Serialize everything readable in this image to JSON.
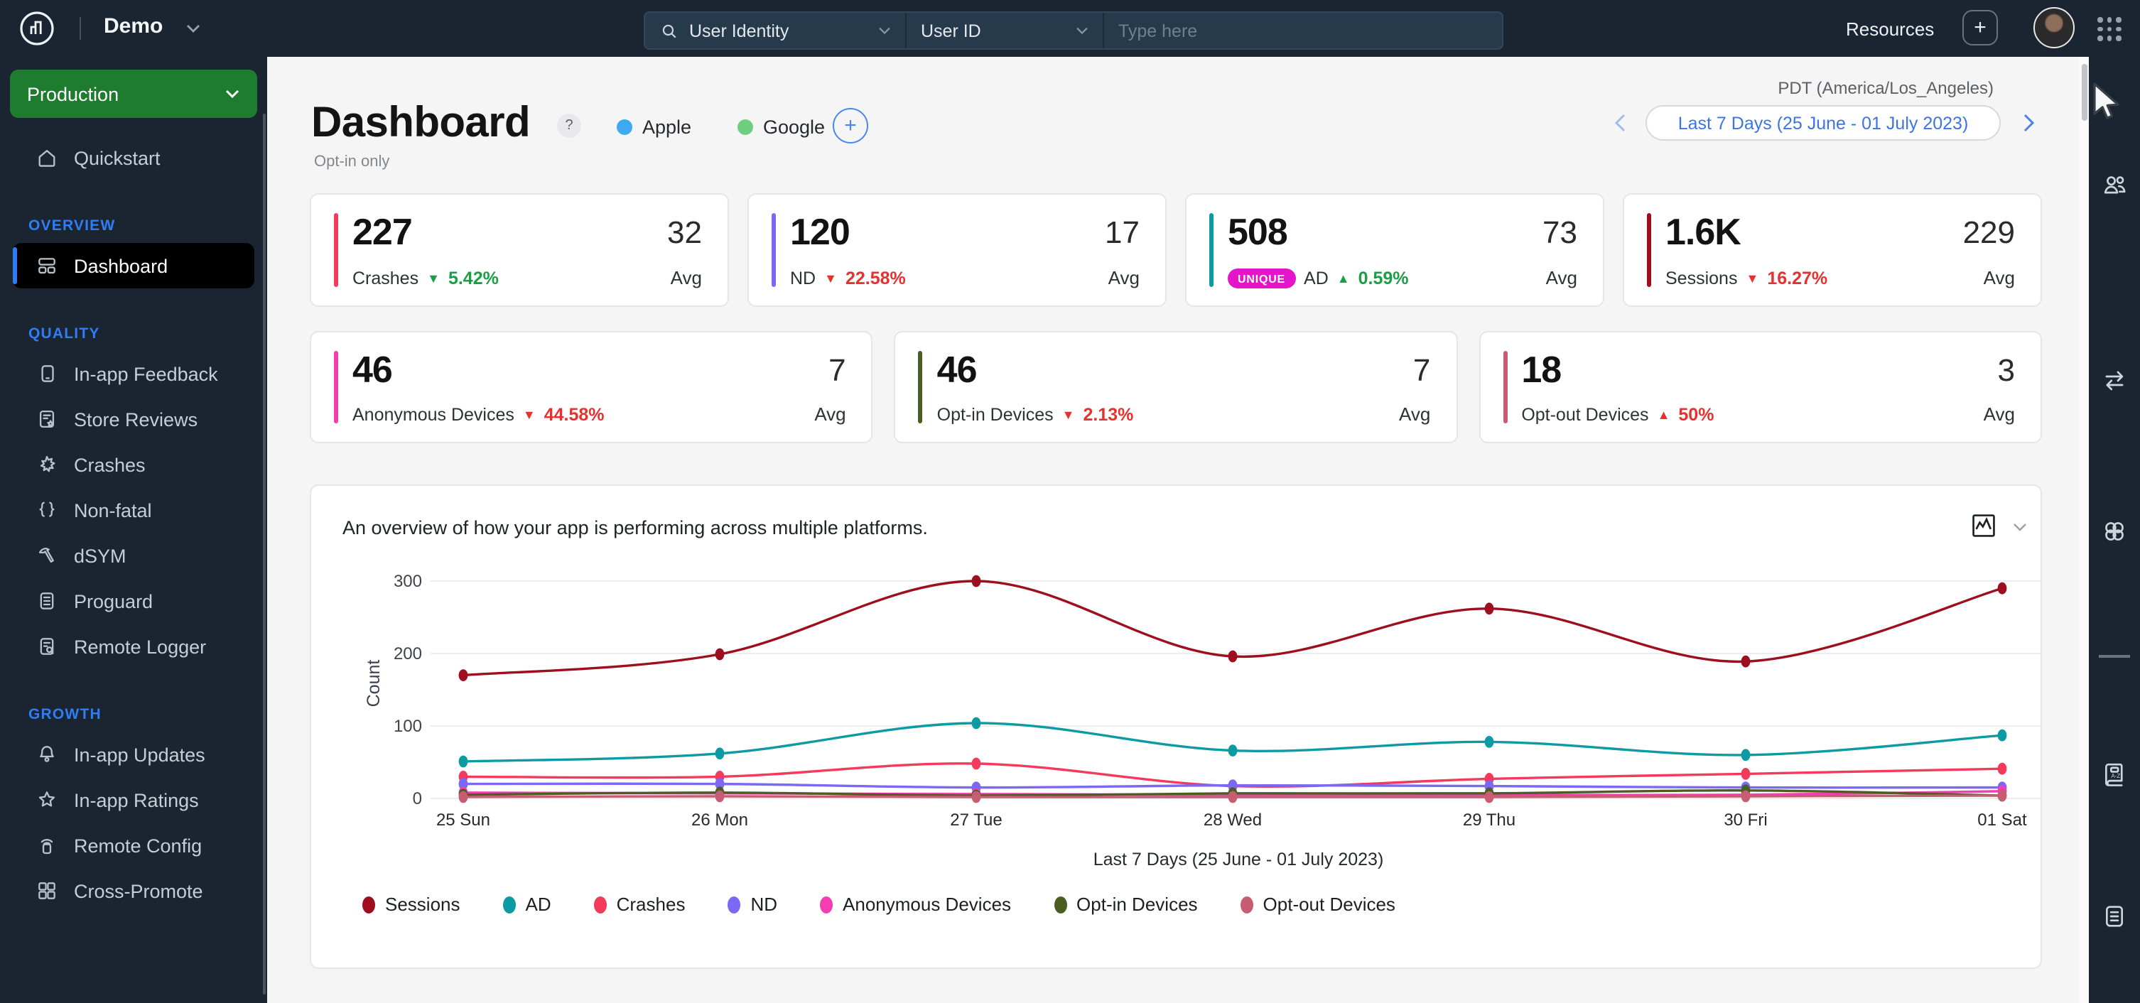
{
  "topbar": {
    "product_name": "Demo",
    "search": {
      "scope": "User Identity",
      "field": "User ID",
      "placeholder": "Type here"
    },
    "resources_label": "Resources",
    "colors": {
      "bar_bg": "#1b2531",
      "panel_bg": "#273a4c"
    }
  },
  "sidebar": {
    "environment": {
      "label": "Production",
      "color": "#1e7c2e"
    },
    "section_label_color": "#2e7df6",
    "groups": [
      {
        "label": "",
        "items": [
          {
            "label": "Quickstart",
            "icon": "home",
            "selected": false
          }
        ]
      },
      {
        "label": "OVERVIEW",
        "items": [
          {
            "label": "Dashboard",
            "icon": "dashboard",
            "selected": true
          }
        ]
      },
      {
        "label": "QUALITY",
        "items": [
          {
            "label": "In-app Feedback",
            "icon": "feedback",
            "selected": false
          },
          {
            "label": "Store Reviews",
            "icon": "store-reviews",
            "selected": false
          },
          {
            "label": "Crashes",
            "icon": "crashes",
            "selected": false
          },
          {
            "label": "Non-fatal",
            "icon": "non-fatal",
            "selected": false
          },
          {
            "label": "dSYM",
            "icon": "dsym",
            "selected": false
          },
          {
            "label": "Proguard",
            "icon": "proguard",
            "selected": false
          },
          {
            "label": "Remote Logger",
            "icon": "remote-logger",
            "selected": false
          }
        ]
      },
      {
        "label": "GROWTH",
        "items": [
          {
            "label": "In-app Updates",
            "icon": "bell",
            "selected": false
          },
          {
            "label": "In-app Ratings",
            "icon": "star",
            "selected": false
          },
          {
            "label": "Remote Config",
            "icon": "remote-config",
            "selected": false
          },
          {
            "label": "Cross-Promote",
            "icon": "cross-promote",
            "selected": false
          }
        ]
      }
    ]
  },
  "header": {
    "title": "Dashboard",
    "help_glyph": "?",
    "subtitle": "Opt-in only",
    "platforms": [
      {
        "label": "Apple",
        "color": "#3daaf0"
      },
      {
        "label": "Google",
        "color": "#6fcf7f"
      }
    ],
    "timezone": "PDT (America/Los_Angeles)",
    "date_range": "Last 7 Days (25 June - 01 July 2023)"
  },
  "stat_cards": [
    {
      "row": 1,
      "value": "227",
      "label": "Crashes",
      "badge": "",
      "delta": "5.42%",
      "delta_dir": "down",
      "delta_color": "#1d9e45",
      "avg_value": "32",
      "avg_label": "Avg",
      "accent": "#f43a5c"
    },
    {
      "row": 1,
      "value": "120",
      "label": "ND",
      "badge": "",
      "delta": "22.58%",
      "delta_dir": "down",
      "delta_color": "#e8312f",
      "avg_value": "17",
      "avg_label": "Avg",
      "accent": "#7b68f5"
    },
    {
      "row": 1,
      "value": "508",
      "label": "AD",
      "badge": "UNIQUE",
      "badge_color": "#e414ca",
      "delta": "0.59%",
      "delta_dir": "up",
      "delta_color": "#1d9e45",
      "avg_value": "73",
      "avg_label": "Avg",
      "accent": "#0d9ba3"
    },
    {
      "row": 1,
      "value": "1.6K",
      "label": "Sessions",
      "badge": "",
      "delta": "16.27%",
      "delta_dir": "down",
      "delta_color": "#e8312f",
      "avg_value": "229",
      "avg_label": "Avg",
      "accent": "#9e0e1e"
    },
    {
      "row": 2,
      "value": "46",
      "label": "Anonymous Devices",
      "badge": "",
      "delta": "44.58%",
      "delta_dir": "down",
      "delta_color": "#e8312f",
      "avg_value": "7",
      "avg_label": "Avg",
      "accent": "#f43eb0"
    },
    {
      "row": 2,
      "value": "46",
      "label": "Opt-in Devices",
      "badge": "",
      "delta": "2.13%",
      "delta_dir": "down",
      "delta_color": "#e8312f",
      "avg_value": "7",
      "avg_label": "Avg",
      "accent": "#4c5d24"
    },
    {
      "row": 2,
      "value": "18",
      "label": "Opt-out Devices",
      "badge": "",
      "delta": "50%",
      "delta_dir": "up",
      "delta_color": "#e8312f",
      "avg_value": "3",
      "avg_label": "Avg",
      "accent": "#c75d73"
    }
  ],
  "chart_data": {
    "type": "line",
    "title": "An overview of how your app is performing across multiple platforms.",
    "ylabel": "Count",
    "xlabel_caption": "Last 7 Days (25 June - 01 July 2023)",
    "ylim": [
      0,
      300
    ],
    "yticks": [
      0,
      100,
      200,
      300
    ],
    "grid": true,
    "legend_position": "bottom",
    "categories": [
      "25 Sun",
      "26 Mon",
      "27 Tue",
      "28 Wed",
      "29 Thu",
      "30 Fri",
      "01 Sat"
    ],
    "series": [
      {
        "name": "Sessions",
        "color": "#9e0e1e",
        "values": [
          170,
          199,
          300,
          196,
          262,
          189,
          290
        ]
      },
      {
        "name": "AD",
        "color": "#0d9ba3",
        "values": [
          51,
          62,
          104,
          66,
          78,
          60,
          87
        ]
      },
      {
        "name": "Crashes",
        "color": "#f43a5c",
        "values": [
          30,
          30,
          48,
          17,
          27,
          34,
          41
        ]
      },
      {
        "name": "ND",
        "color": "#7b68f5",
        "values": [
          20,
          20,
          15,
          18,
          17,
          15,
          15
        ]
      },
      {
        "name": "Anonymous Devices",
        "color": "#f43eb0",
        "values": [
          8,
          7,
          6,
          5,
          5,
          5,
          10
        ]
      },
      {
        "name": "Opt-in Devices",
        "color": "#4c5d24",
        "values": [
          5,
          8,
          4,
          7,
          7,
          11,
          4
        ]
      },
      {
        "name": "Opt-out Devices",
        "color": "#c75d73",
        "values": [
          2,
          3,
          2,
          2,
          2,
          3,
          4
        ]
      }
    ]
  },
  "right_rail": {
    "icons": [
      "users",
      "swap-arrows",
      "clover",
      "divider",
      "glossary-book",
      "document"
    ]
  }
}
